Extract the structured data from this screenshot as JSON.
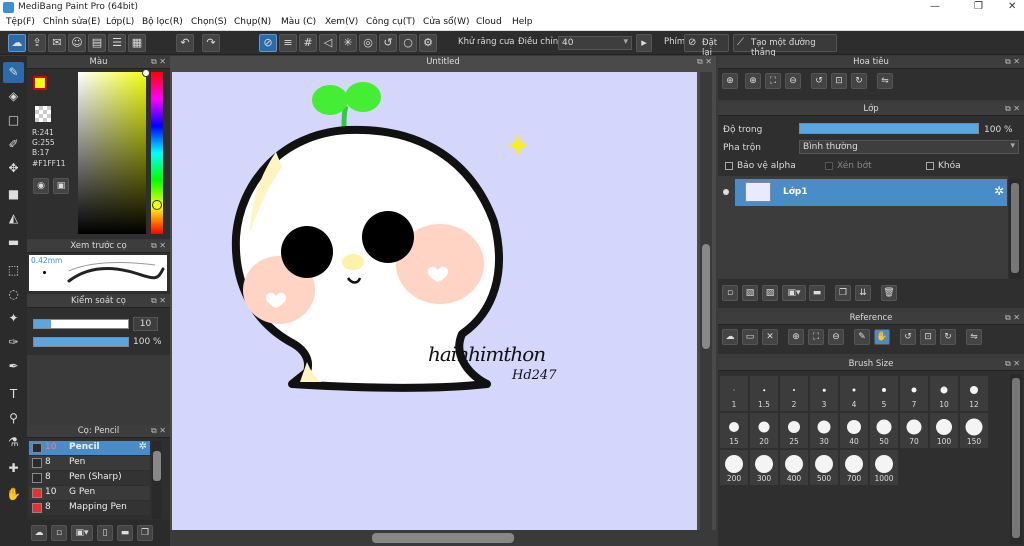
{
  "window": {
    "title": "MediBang Paint Pro (64bit)",
    "minimize": "—",
    "maximize": "❐",
    "close": "✕"
  },
  "menu": [
    "Tệp(F)",
    "Chỉnh sửa(E)",
    "Lớp(L)",
    "Bộ lọc(R)",
    "Chọn(S)",
    "Chụp(N)",
    "Màu (C)",
    "Xem(V)",
    "Công cụ(T)",
    "Cửa sổ(W)",
    "Cloud",
    "Help"
  ],
  "toolbar": {
    "antialias_label": "Khử răng cưa",
    "adjust_label": "Điều chỉnh",
    "adjust_value": "40",
    "keys_label": "Phím",
    "reset_label": "Đặt lại",
    "line_label": "Tạo một đường thẳng"
  },
  "color_panel": {
    "title": "Màu",
    "r": "R:241",
    "g": "G:255",
    "b": "B:17",
    "hex": "#F1FF11",
    "main_color": "#F1FF11"
  },
  "brush_preview": {
    "title": "Xem trước cọ",
    "size": "0.42mm"
  },
  "brush_control": {
    "title": "Kiểm soát cọ",
    "size_value": "10",
    "opacity_value": "100 %"
  },
  "brush_list": {
    "title": "Cọ: Pencil",
    "items": [
      {
        "size": "10",
        "name": "Pencil",
        "color": "#2a2a2a",
        "selected": true
      },
      {
        "size": "8",
        "name": "Pen",
        "color": "#2a2a2a"
      },
      {
        "size": "8",
        "name": "Pen (Sharp)",
        "color": "#2a2a2a"
      },
      {
        "size": "10",
        "name": "G Pen",
        "color": "#e83030"
      },
      {
        "size": "8",
        "name": "Mapping Pen",
        "color": "#e83030"
      }
    ]
  },
  "canvas": {
    "tab_title": "Untitled",
    "background": "#D4D7FB",
    "signature_line1": "hainhimthon",
    "signature_line2": "Hd247"
  },
  "navigator": {
    "title": "Hoa tiêu"
  },
  "layer_panel": {
    "title": "Lớp",
    "opacity_label": "Độ trong",
    "opacity_value": "100 %",
    "blend_label": "Pha trộn",
    "blend_value": "Bình thường",
    "protect_alpha": "Bảo vệ alpha",
    "clipping": "Xén bớt",
    "lock": "Khóa",
    "layers": [
      {
        "name": "Lớp1"
      }
    ]
  },
  "reference": {
    "title": "Reference"
  },
  "brush_size": {
    "title": "Brush Size",
    "sizes": [
      "1",
      "1.5",
      "2",
      "3",
      "4",
      "5",
      "7",
      "10",
      "12",
      "15",
      "20",
      "25",
      "30",
      "40",
      "50",
      "70",
      "100",
      "150",
      "200",
      "300",
      "400",
      "500",
      "700",
      "1000"
    ]
  }
}
